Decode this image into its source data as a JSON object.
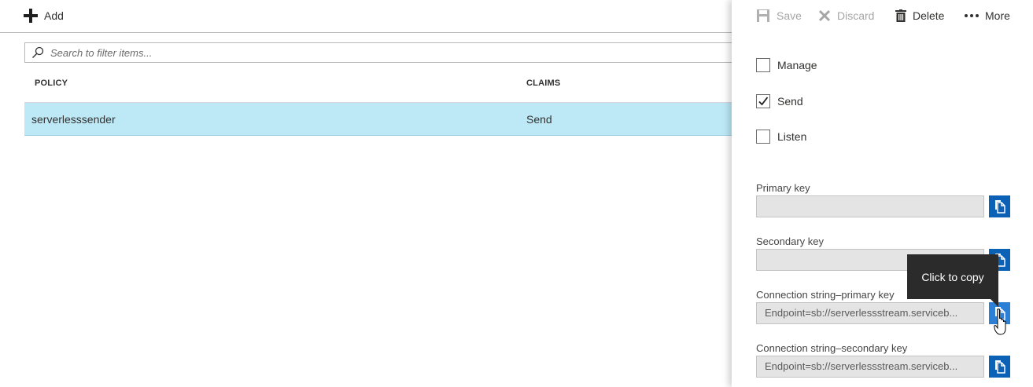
{
  "toolbar": {
    "add_label": "Add"
  },
  "search": {
    "placeholder": "Search to filter items..."
  },
  "table": {
    "columns": [
      "POLICY",
      "CLAIMS"
    ],
    "rows": [
      {
        "policy": "serverlesssender",
        "claims": "Send",
        "selected": true
      }
    ]
  },
  "panel": {
    "toolbar": {
      "save_label": "Save",
      "discard_label": "Discard",
      "delete_label": "Delete",
      "more_label": "More"
    },
    "claims": [
      {
        "label": "Manage",
        "checked": false
      },
      {
        "label": "Send",
        "checked": true
      },
      {
        "label": "Listen",
        "checked": false
      }
    ],
    "keys": {
      "primary_label": "Primary key",
      "primary_value": "",
      "secondary_label": "Secondary key",
      "secondary_value": "",
      "conn_primary_label": "Connection string–primary key",
      "conn_primary_value": "Endpoint=sb://serverlessstream.serviceb...",
      "conn_secondary_label": "Connection string–secondary key",
      "conn_secondary_value": "Endpoint=sb://serverlessstream.serviceb..."
    },
    "tooltip": "Click to copy"
  },
  "colors": {
    "selected_row": "#bde9f7",
    "copy_button": "#0a61b5",
    "copy_button_hover": "#2b7fd4",
    "tooltip_bg": "#2b2b2b"
  },
  "icons": [
    "plus-icon",
    "search-icon",
    "save-icon",
    "discard-icon",
    "delete-icon",
    "more-icon",
    "checkmark-icon",
    "copy-icon",
    "hand-cursor-icon"
  ]
}
